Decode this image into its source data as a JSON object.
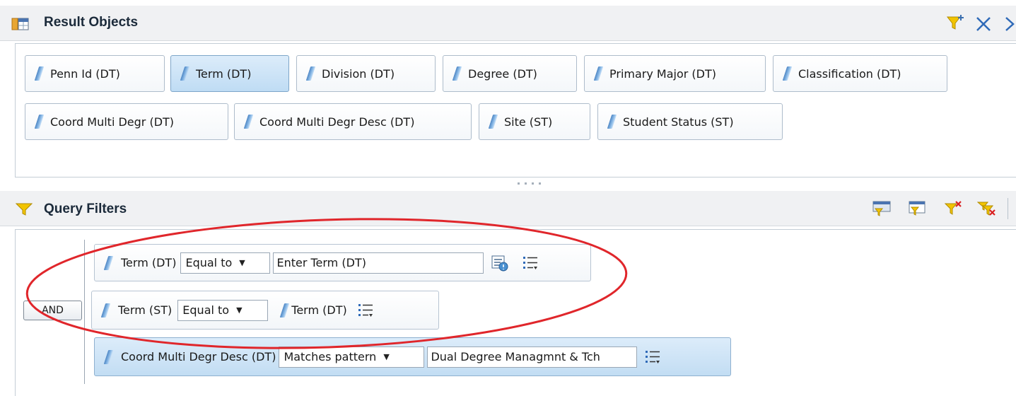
{
  "result_objects": {
    "title": "Result Objects",
    "chips": [
      {
        "label": "Penn Id (DT)"
      },
      {
        "label": "Term (DT)",
        "selected": true
      },
      {
        "label": "Division (DT)"
      },
      {
        "label": "Degree (DT)"
      },
      {
        "label": "Primary Major (DT)"
      },
      {
        "label": "Classification (DT)"
      },
      {
        "label": "Coord Multi Degr (DT)"
      },
      {
        "label": "Coord Multi Degr Desc (DT)"
      },
      {
        "label": "Site (ST)"
      },
      {
        "label": "Student Status (ST)"
      }
    ]
  },
  "query_filters": {
    "title": "Query Filters",
    "and_label": "AND",
    "rows": [
      {
        "object": "Term (DT)",
        "operator": "Equal to",
        "operand": "Enter Term (DT)"
      },
      {
        "object": "Term (ST)",
        "operator": "Equal to",
        "operand": "Term (DT)"
      },
      {
        "object": "Coord Multi Degr Desc (DT)",
        "operator": "Matches pattern",
        "operand": "Dual Degree Managmnt & Tch"
      }
    ]
  },
  "colors": {
    "annotation_ellipse": "#e0262b",
    "header_bg": "#f0f1f3",
    "selected_bg": "#c8e1f6",
    "dimension_icon": "#5b93cf"
  }
}
